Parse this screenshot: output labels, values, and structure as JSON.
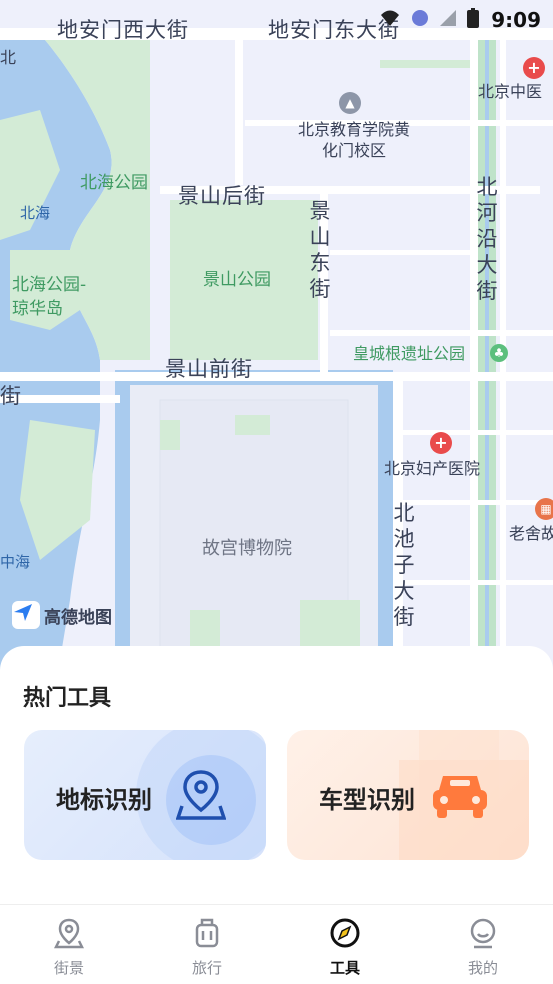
{
  "status_bar": {
    "time": "9:09"
  },
  "map": {
    "streets": [
      "地安门西大街",
      "地安门东大街",
      "景山后街",
      "景山前街",
      "景山东街",
      "北河沿大街",
      "北池子大街",
      "街"
    ],
    "parks": [
      "北海公园",
      "景山公园",
      "北海公园-琼华岛"
    ],
    "water": [
      "北海",
      "中海"
    ],
    "pois": {
      "school": "北京教育学院黄化门校区",
      "site_park": "皇城根遗址公园",
      "palace": "故宫博物院",
      "hospital1": "北京中医",
      "hospital2": "北京妇产医院",
      "museum": "老舍故",
      "left_edge": "北"
    },
    "provider_logo": "高德地图"
  },
  "tools": {
    "title": "热门工具",
    "cards": [
      {
        "label": "地标识别",
        "icon": "map-pin-icon",
        "color": "#1f4fae"
      },
      {
        "label": "车型识别",
        "icon": "car-icon",
        "color": "#ff7a3d"
      }
    ]
  },
  "tabbar": {
    "items": [
      {
        "label": "街景",
        "icon": "street-view-icon"
      },
      {
        "label": "旅行",
        "icon": "luggage-icon"
      },
      {
        "label": "工具",
        "icon": "compass-icon",
        "active": true
      },
      {
        "label": "我的",
        "icon": "profile-icon"
      }
    ]
  }
}
